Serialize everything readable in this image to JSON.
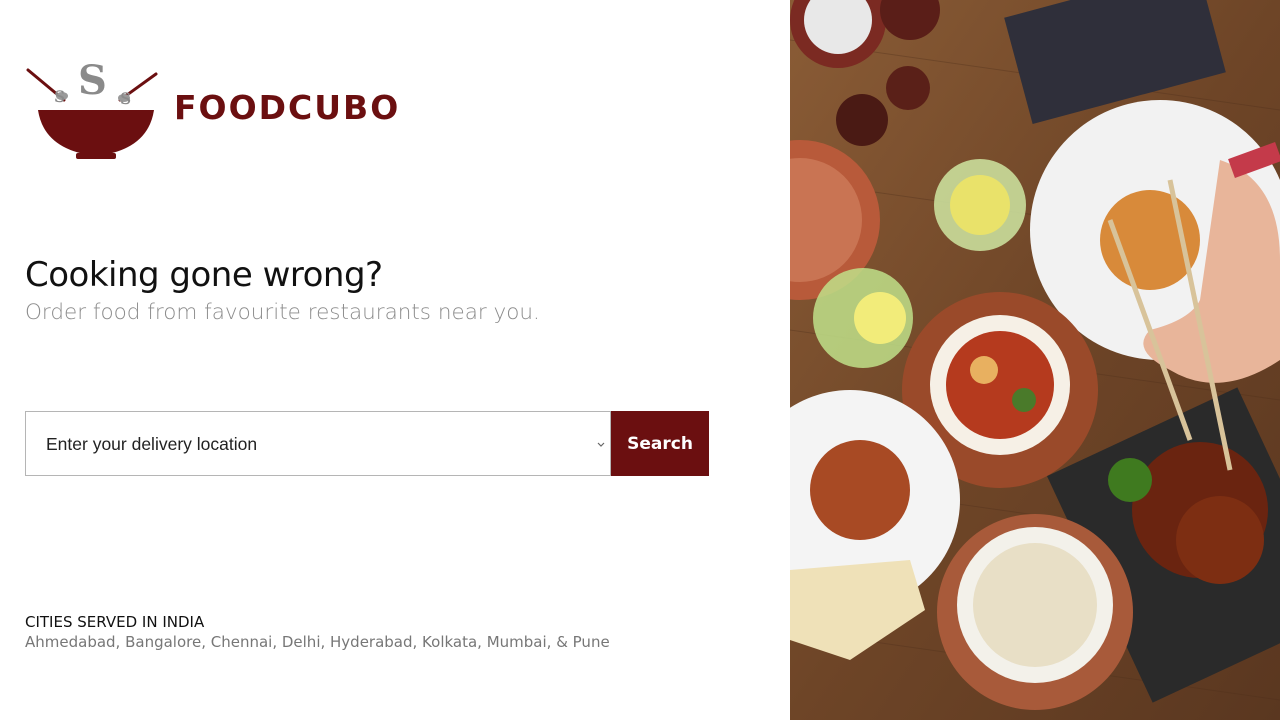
{
  "brand": {
    "name": "FOODCUBO",
    "color": "#6b0f10"
  },
  "hero": {
    "headline": "Cooking gone wrong?",
    "subline": "Order food from favourite restaurants near you."
  },
  "search": {
    "location_placeholder": "Enter your delivery location",
    "button_label": "Search"
  },
  "cities": {
    "title": "CITIES SERVED IN INDIA",
    "list": "Ahmedabad, Bangalore, Chennai, Delhi, Hyderabad, Kolkata, Mumbai, & Pune"
  },
  "icons": {
    "logo": "food-bowl-logo-icon",
    "dropdown": "chevron-down-icon"
  },
  "colors": {
    "accent": "#6b0f10",
    "subtext": "#8c8c8c",
    "table_wood": "#7a5232"
  }
}
